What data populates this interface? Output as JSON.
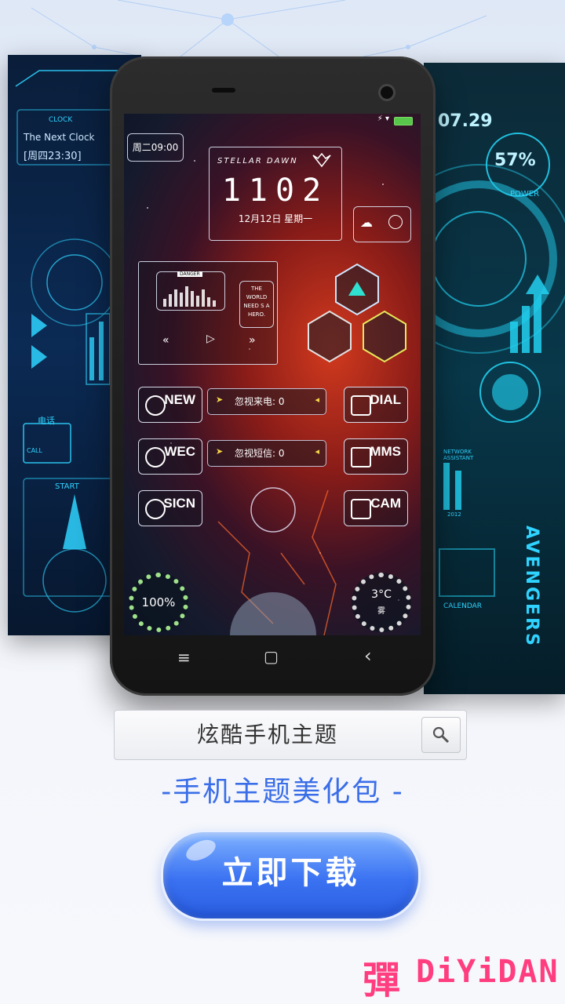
{
  "left_panel": {
    "clock_label": "CLOCK",
    "clock_title": "The Next Clock",
    "clock_time": "[周四23:30]",
    "phone_label": "电话",
    "call_label": "CALL",
    "start_label": "START"
  },
  "right_panel": {
    "date": "07.29",
    "battery": "57%",
    "power_label": "POWER",
    "network_label": "NETWORK ASSISTANT",
    "avengers": "AVENGERS",
    "calendar_label": "CALENDAR",
    "year_label": "2012"
  },
  "phone_screen": {
    "week_time": "周二09:00",
    "stellar_title": "STELLAR DAWN",
    "clock": "1102",
    "date": "12月12日  星期一",
    "danger": "DANGER",
    "hero_text": "THE WORLD NEED S A HERO.",
    "buttons": {
      "new": "NEW",
      "dial": "DIAL",
      "wec": "WEC",
      "mms": "MMS",
      "sicn": "SICN",
      "cam": "CAM"
    },
    "missed_calls": "忽视来电: 0",
    "missed_sms": "忽视短信: 0",
    "battery_gauge": "100%",
    "weather_temp": "3°C",
    "weather_desc": "雾"
  },
  "phone_nav": {
    "menu": "≡",
    "home": "▢",
    "back": "‹"
  },
  "search": {
    "text": "炫酷手机主题"
  },
  "subtitle": "-手机主题美化包 -",
  "download_button": "立即下载",
  "brand": {
    "glyph": "彈",
    "name": "DiYiDAN"
  }
}
